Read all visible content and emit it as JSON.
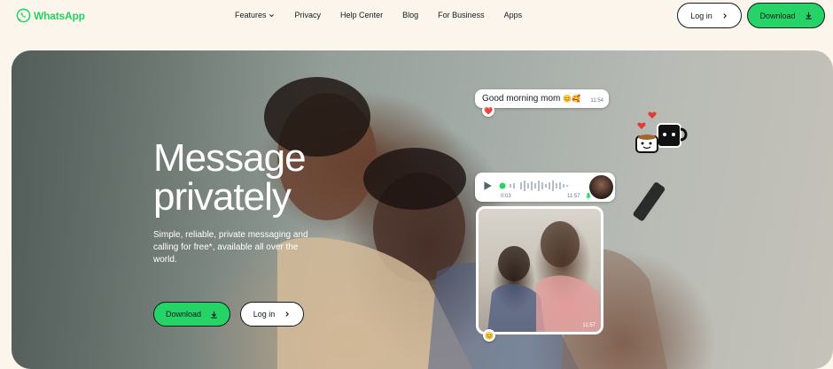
{
  "brand": {
    "name": "WhatsApp",
    "color": "#25d366"
  },
  "nav": {
    "links": [
      {
        "label": "Features",
        "dropdown": true
      },
      {
        "label": "Privacy"
      },
      {
        "label": "Help Center"
      },
      {
        "label": "Blog"
      },
      {
        "label": "For Business"
      },
      {
        "label": "Apps"
      }
    ],
    "login_label": "Log in",
    "download_label": "Download"
  },
  "hero": {
    "headline_line1": "Message",
    "headline_line2": "privately",
    "subtext": "Simple, reliable, private messaging and calling for free*, available all over the world.",
    "download_label": "Download",
    "login_label": "Log in"
  },
  "chat": {
    "message_text": "Good morning mom",
    "message_emojis": "😊🥰",
    "message_time": "11:54",
    "message_reaction": "❤️",
    "voice_duration": "0:03",
    "voice_time": "11:57",
    "photo_time": "11:57",
    "photo_reaction": "😊"
  },
  "icons": {
    "logo": "whatsapp-logo-icon",
    "chevron": "chevron-down-icon",
    "arrow": "chevron-right-icon",
    "download": "download-icon",
    "play": "play-icon",
    "mic": "mic-icon",
    "sticker": "coffee-cups-sticker"
  },
  "colors": {
    "accent": "#25d366",
    "background": "#fcf5eb",
    "text": "#111b21"
  }
}
